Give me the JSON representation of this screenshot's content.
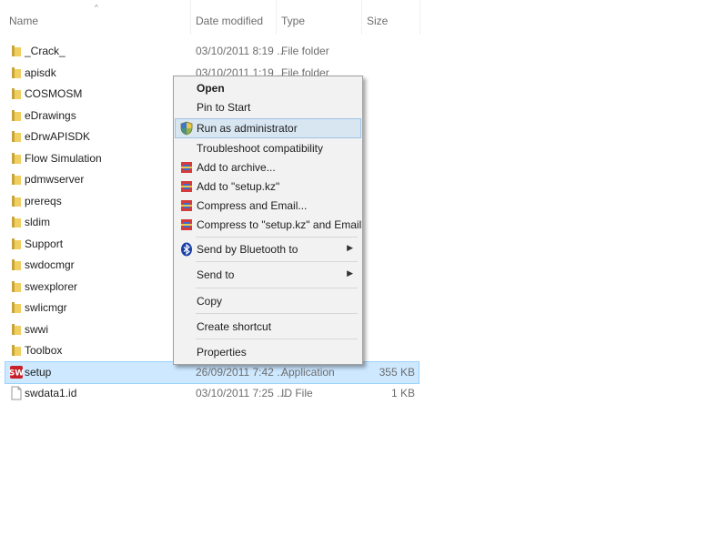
{
  "columns": {
    "name": "Name",
    "date": "Date modified",
    "type": "Type",
    "size": "Size"
  },
  "files": [
    {
      "name": "_Crack_",
      "date": "03/10/2011 8:19 ...",
      "type": "File folder",
      "size": "",
      "icon": "folder-icon"
    },
    {
      "name": "apisdk",
      "date": "03/10/2011 1:19 ...",
      "type": "File folder",
      "size": "",
      "icon": "folder-icon"
    },
    {
      "name": "COSMOSM",
      "date": "",
      "type": "",
      "size": "",
      "icon": "folder-icon"
    },
    {
      "name": "eDrawings",
      "date": "",
      "type": "",
      "size": "",
      "icon": "folder-icon"
    },
    {
      "name": "eDrwAPISDK",
      "date": "",
      "type": "",
      "size": "",
      "icon": "folder-icon"
    },
    {
      "name": "Flow Simulation",
      "date": "",
      "type": "",
      "size": "",
      "icon": "folder-icon"
    },
    {
      "name": "pdmwserver",
      "date": "",
      "type": "",
      "size": "",
      "icon": "folder-icon"
    },
    {
      "name": "prereqs",
      "date": "",
      "type": "",
      "size": "",
      "icon": "folder-icon"
    },
    {
      "name": "sldim",
      "date": "",
      "type": "",
      "size": "",
      "icon": "folder-icon"
    },
    {
      "name": "Support",
      "date": "",
      "type": "",
      "size": "",
      "icon": "folder-icon"
    },
    {
      "name": "swdocmgr",
      "date": "",
      "type": "",
      "size": "",
      "icon": "folder-icon"
    },
    {
      "name": "swexplorer",
      "date": "",
      "type": "",
      "size": "",
      "icon": "folder-icon"
    },
    {
      "name": "swlicmgr",
      "date": "",
      "type": "",
      "size": "",
      "icon": "folder-icon"
    },
    {
      "name": "swwi",
      "date": "",
      "type": "",
      "size": "",
      "icon": "folder-icon"
    },
    {
      "name": "Toolbox",
      "date": "",
      "type": "",
      "size": "",
      "icon": "folder-icon"
    },
    {
      "name": "setup",
      "date": "26/09/2011 7:42 ...",
      "type": "Application",
      "size": "355 KB",
      "icon": "app-icon"
    },
    {
      "name": "swdata1.id",
      "date": "03/10/2011 7:25 ...",
      "type": "ID File",
      "size": "1 KB",
      "icon": "file-icon"
    }
  ],
  "context_menu": {
    "open": "Open",
    "pin_start": "Pin to Start",
    "run_admin": "Run as administrator",
    "troubleshoot": "Troubleshoot compatibility",
    "add_archive": "Add to archive...",
    "add_setup_kz": "Add to \"setup.kz\"",
    "compress_email": "Compress and Email...",
    "compress_setup_email": "Compress to  \"setup.kz\" and Email",
    "send_bluetooth": "Send by Bluetooth to",
    "send_to": "Send to",
    "copy": "Copy",
    "create_shortcut": "Create shortcut",
    "properties": "Properties"
  }
}
